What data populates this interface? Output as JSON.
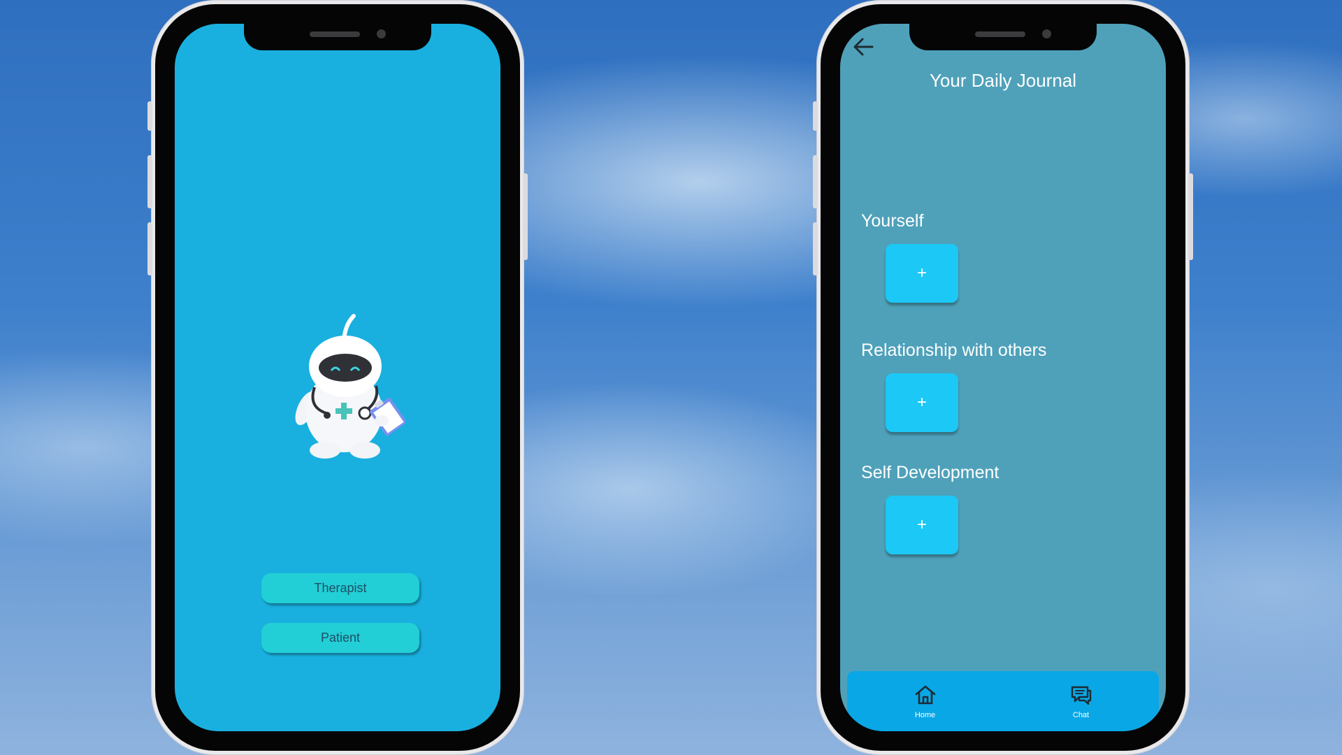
{
  "welcome_screen": {
    "buttons": [
      {
        "label": "Therapist"
      },
      {
        "label": "Patient"
      }
    ]
  },
  "journal_screen": {
    "title": "Your Daily Journal",
    "sections": [
      {
        "label": "Yourself",
        "add_label": "+"
      },
      {
        "label": "Relationship with others",
        "add_label": "+"
      },
      {
        "label": "Self Development",
        "add_label": "+"
      }
    ],
    "bottom_nav": [
      {
        "label": "Home",
        "icon": "home-icon"
      },
      {
        "label": "Chat",
        "icon": "chat-icon"
      }
    ]
  },
  "colors": {
    "welcome_bg": "#19b0df",
    "journal_bg": "#4fa1ba",
    "role_button": "#22cfd6",
    "add_button": "#1cc8f6",
    "nav_bar": "#0aa7e6"
  }
}
